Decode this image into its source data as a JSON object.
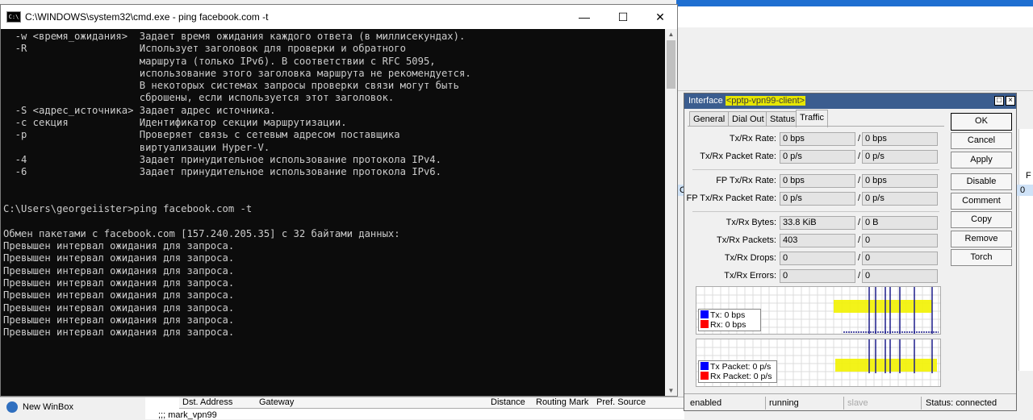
{
  "cmd": {
    "title": "C:\\WINDOWS\\system32\\cmd.exe - ping  facebook.com -t",
    "icon_text": "C:\\",
    "lines": [
      "  -w <время_ожидания>  Задает время ожидания каждого ответа (в миллисекундах).",
      "  -R                   Использует заголовок для проверки и обратного",
      "                       маршрута (только IPv6). В соответствии с RFC 5095,",
      "                       использование этого заголовка маршрута не рекомендуется.",
      "                       В некоторых системах запросы проверки связи могут быть",
      "                       сброшены, если используется этот заголовок.",
      "  -S <адрес_источника> Задает адрес источника.",
      "  -c секция            Идентификатор секции маршрутизации.",
      "  -p                   Проверяет связь с сетевым адресом поставщика",
      "                       виртуализации Hyper-V.",
      "  -4                   Задает принудительное использование протокола IPv4.",
      "  -6                   Задает принудительное использование протокола IPv6.",
      "",
      "",
      "C:\\Users\\georgeiister>ping facebook.com -t",
      "",
      "Обмен пакетами с facebook.com [157.240.205.35] с 32 байтами данных:",
      "Превышен интервал ожидания для запроса.",
      "Превышен интервал ожидания для запроса.",
      "Превышен интервал ожидания для запроса.",
      "Превышен интервал ожидания для запроса.",
      "Превышен интервал ожидания для запроса.",
      "Превышен интервал ожидания для запроса.",
      "Превышен интервал ожидания для запроса.",
      "Превышен интервал ожидания для запроса."
    ]
  },
  "background": {
    "new_winbox": "New WinBox",
    "col_header_f": "F",
    "col_value_0": "0",
    "col_value_c": "C",
    "table_headers": [
      "Dst. Address",
      "Gateway",
      "Distance",
      "Routing Mark",
      "Pref. Source"
    ],
    "table_row": ";;; mark_vpn99"
  },
  "dialog": {
    "title_prefix": "Interface ",
    "title_name": "<pptp-vpn99-client>",
    "tabs": [
      "General",
      "Dial Out",
      "Status",
      "Traffic"
    ],
    "active_tab": "Traffic",
    "rows": [
      {
        "label": "Tx/Rx Rate:",
        "tx": "0 bps",
        "rx": "0 bps"
      },
      {
        "label": "Tx/Rx Packet Rate:",
        "tx": "0 p/s",
        "rx": "0 p/s"
      },
      {
        "label": "FP Tx/Rx Rate:",
        "tx": "0 bps",
        "rx": "0 bps"
      },
      {
        "label": "FP Tx/Rx Packet Rate:",
        "tx": "0 p/s",
        "rx": "0 p/s"
      },
      {
        "label": "Tx/Rx Bytes:",
        "tx": "33.8 KiB",
        "rx": "0 B"
      },
      {
        "label": "Tx/Rx Packets:",
        "tx": "403",
        "rx": "0"
      },
      {
        "label": "Tx/Rx Drops:",
        "tx": "0",
        "rx": "0"
      },
      {
        "label": "Tx/Rx Errors:",
        "tx": "0",
        "rx": "0"
      }
    ],
    "graph1": {
      "tx_label": "Tx:",
      "tx_value": "0 bps",
      "rx_label": "Rx:",
      "rx_value": "0 bps"
    },
    "graph2": {
      "tx_label": "Tx Packet:",
      "tx_value": "0 p/s",
      "rx_label": "Rx Packet:",
      "rx_value": "0 p/s"
    },
    "buttons": [
      "OK",
      "Cancel",
      "Apply",
      "Disable",
      "Comment",
      "Copy",
      "Remove",
      "Torch"
    ],
    "status": [
      "enabled",
      "running",
      "slave",
      "Status: connected"
    ],
    "colors": {
      "tx": "#0000ff",
      "rx": "#ff0000",
      "highlight": "#e6e600",
      "title_bar": "#3b5d8f"
    }
  }
}
